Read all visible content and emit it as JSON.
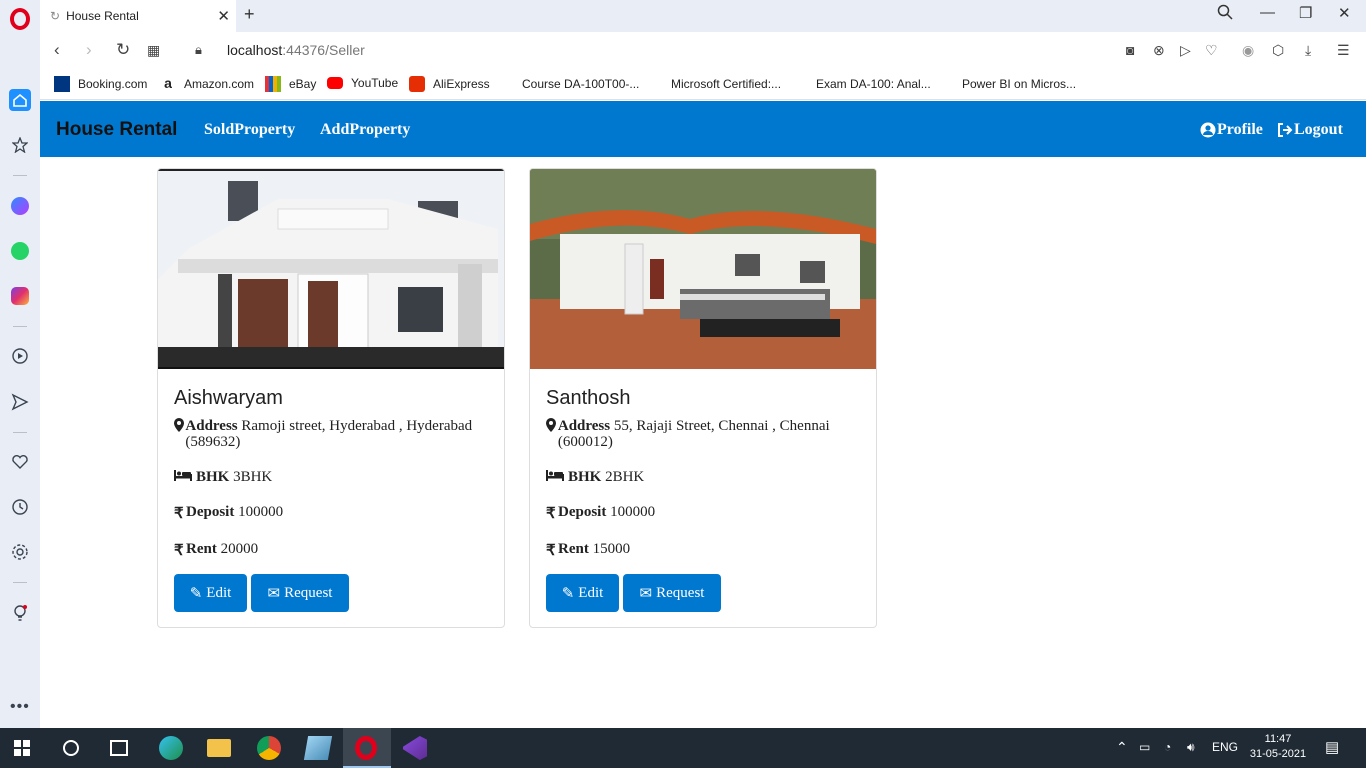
{
  "browser": {
    "tab_title": "House Rental",
    "url_host": "localhost",
    "url_path": ":44376/Seller",
    "bookmarks": [
      "Booking.com",
      "Amazon.com",
      "eBay",
      "YouTube",
      "AliExpress",
      "Course DA-100T00-...",
      "Microsoft Certified:...",
      "Exam DA-100: Anal...",
      "Power BI on Micros..."
    ]
  },
  "navbar": {
    "brand": "House Rental",
    "links": [
      "SoldProperty",
      "AddProperty"
    ],
    "profile": "Profile",
    "logout": "Logout"
  },
  "properties": [
    {
      "name": "Aishwaryam",
      "address_label": "Address",
      "address": "Ramoji street, Hyderabad , Hyderabad (589632)",
      "bhk_label": "BHK",
      "bhk": "3BHK",
      "deposit_label": "Deposit",
      "deposit": "100000",
      "rent_label": "Rent",
      "rent": "20000",
      "edit": "Edit",
      "request": "Request"
    },
    {
      "name": "Santhosh",
      "address_label": "Address",
      "address": "55, Rajaji Street, Chennai , Chennai (600012)",
      "bhk_label": "BHK",
      "bhk": "2BHK",
      "deposit_label": "Deposit",
      "deposit": "100000",
      "rent_label": "Rent",
      "rent": "15000",
      "edit": "Edit",
      "request": "Request"
    }
  ],
  "taskbar": {
    "lang": "ENG",
    "time": "11:47",
    "date": "31-05-2021"
  },
  "colors": {
    "brand_blue": "#0078d0",
    "taskbar": "#1f2a34"
  }
}
